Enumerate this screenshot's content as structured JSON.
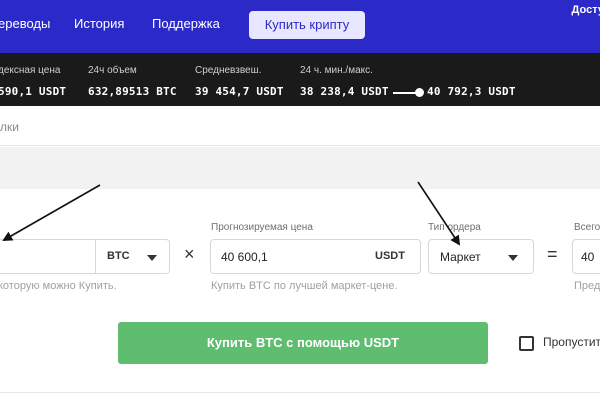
{
  "nav": {
    "items": [
      "ереводы",
      "История",
      "Поддержка"
    ],
    "buy_crypto": "Купить крипту",
    "right_label": "Досту"
  },
  "stats": [
    {
      "label": "дексная цена",
      "value": "590,1 USDT"
    },
    {
      "label": "24ч объем",
      "value": "632,89513 BTC"
    },
    {
      "label": "Средневзвеш.",
      "value": "39 454,7 USDT"
    },
    {
      "label": "24 ч. мин./макс.",
      "min": "38 238,4 USDT",
      "max": "40 792,3 USDT"
    }
  ],
  "breadcrumb": "лки",
  "form": {
    "amount": {
      "unit": "BTC",
      "hint": "которую можно Купить."
    },
    "price": {
      "label": "Прогнозируемая цена",
      "value": "40 600,1",
      "unit": "USDT",
      "hint": "Купить BTC по лучшей маркет-цене."
    },
    "order_type": {
      "label": "Тип ордера",
      "value": "Маркет"
    },
    "total": {
      "label": "Всего",
      "value": "40",
      "hint": "Пред"
    },
    "multiply": "×",
    "equals": "=",
    "buy_button": "Купить BTC с помощью USDT",
    "skip_label": "Пропустит"
  }
}
